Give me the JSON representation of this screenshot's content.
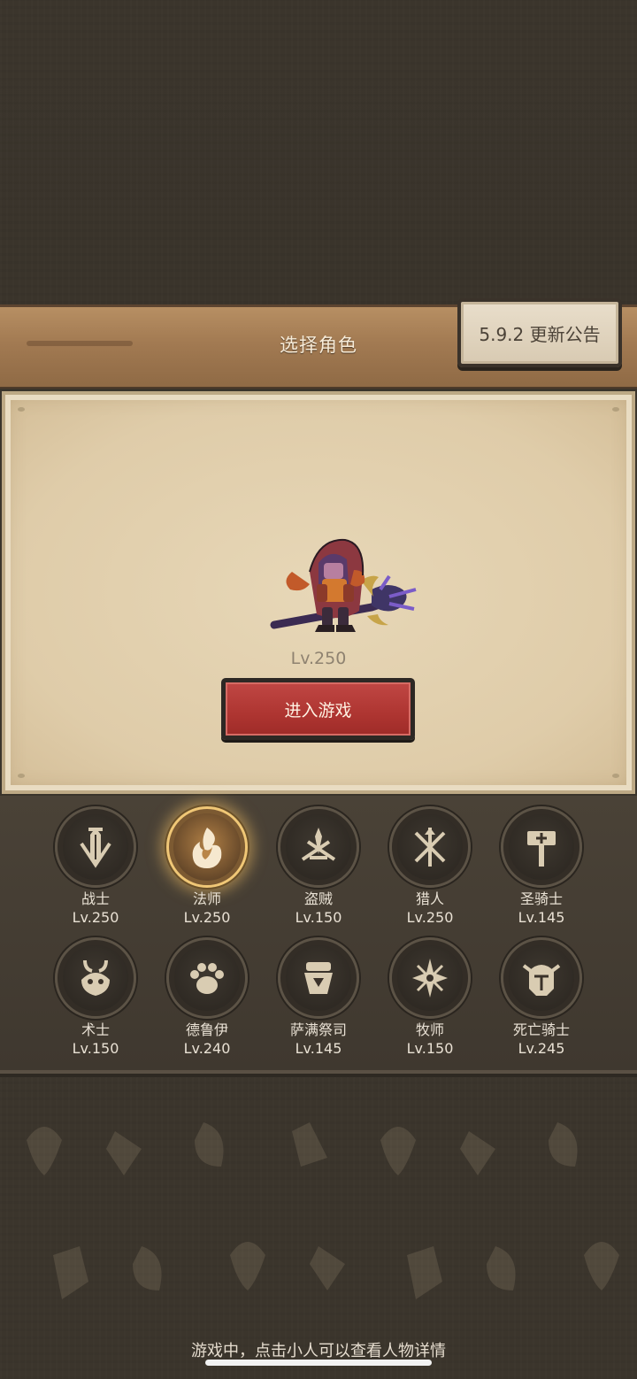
{
  "header": {
    "title": "选择角色",
    "notice_label": "5.9.2 更新公告"
  },
  "character": {
    "level": "Lv.250",
    "enter_label": "进入游戏"
  },
  "classes": [
    {
      "name": "战士",
      "level": "Lv.250",
      "icon": "warrior-sword-icon",
      "selected": false
    },
    {
      "name": "法师",
      "level": "Lv.250",
      "icon": "mage-flame-icon",
      "selected": true
    },
    {
      "name": "盗贼",
      "level": "Lv.150",
      "icon": "rogue-daggers-icon",
      "selected": false
    },
    {
      "name": "猎人",
      "level": "Lv.250",
      "icon": "hunter-arrows-icon",
      "selected": false
    },
    {
      "name": "圣骑士",
      "level": "Lv.145",
      "icon": "paladin-hammer-icon",
      "selected": false
    },
    {
      "name": "术士",
      "level": "Lv.150",
      "icon": "warlock-skull-icon",
      "selected": false
    },
    {
      "name": "德鲁伊",
      "level": "Lv.240",
      "icon": "druid-paw-icon",
      "selected": false
    },
    {
      "name": "萨满祭司",
      "level": "Lv.145",
      "icon": "shaman-totem-icon",
      "selected": false
    },
    {
      "name": "牧师",
      "level": "Lv.150",
      "icon": "priest-star-icon",
      "selected": false
    },
    {
      "name": "死亡骑士",
      "level": "Lv.245",
      "icon": "deathknight-helm-icon",
      "selected": false
    }
  ],
  "footer": {
    "tip": "游戏中，点击小人可以查看人物详情"
  },
  "colors": {
    "background": "#3a342b",
    "wood": "#a27a52",
    "parchment": "#dfcca9",
    "enter_button": "#ae3531",
    "selected_glow": "#f0c776"
  }
}
